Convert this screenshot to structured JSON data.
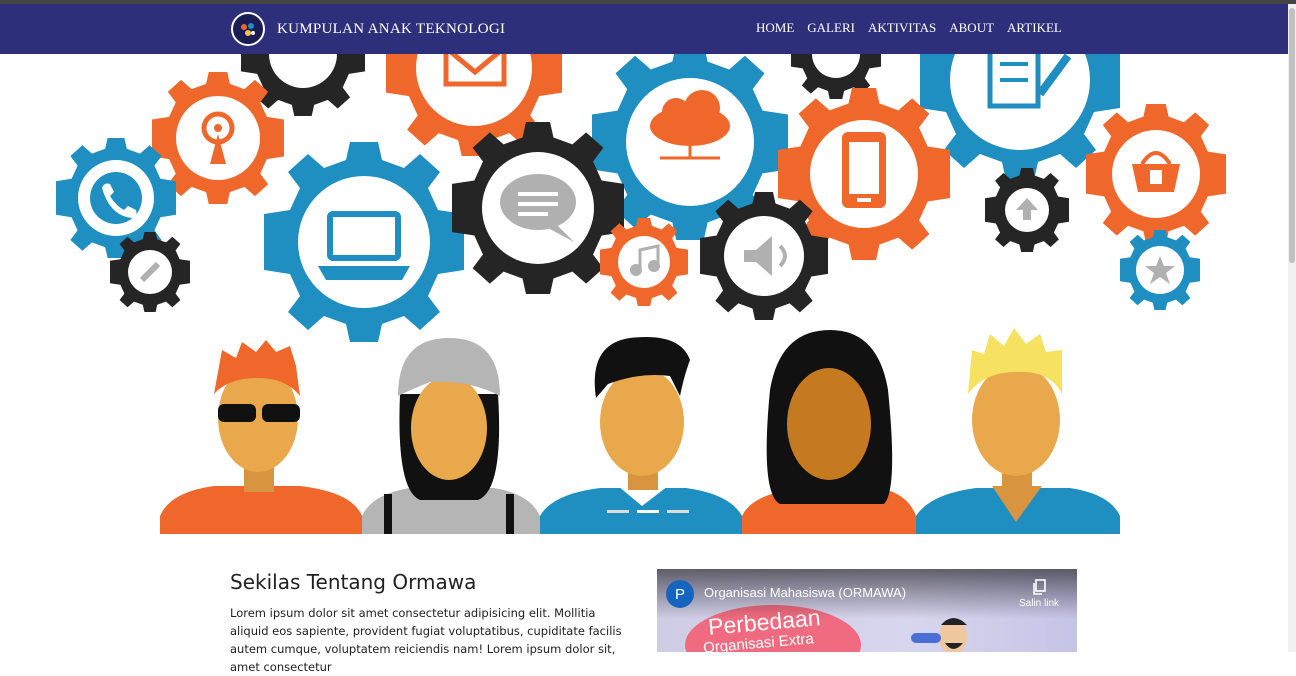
{
  "navbar": {
    "brand": "KUMPULAN ANAK TEKNOLOGI",
    "logo_icon": "kuat-logo-icon",
    "items": [
      {
        "label": "HOME"
      },
      {
        "label": "GALERI"
      },
      {
        "label": "AKTIVITAS"
      },
      {
        "label": "ABOUT"
      },
      {
        "label": "ARTIKEL"
      }
    ],
    "background": "#2d2f7a"
  },
  "hero": {
    "carousel_active_index": 1,
    "carousel_count": 3,
    "colors": {
      "orange": "#f0672b",
      "blue": "#1e8fc0",
      "dark": "#252525"
    }
  },
  "about": {
    "title": "Sekilas Tentang Ormawa",
    "text": "Lorem ipsum dolor sit amet consectetur adipisicing elit. Mollitia aliquid eos sapiente, provident fugiat voluptatibus, cupiditate facilis autem cumque, voluptatem reiciendis nam! Lorem ipsum dolor sit, amet consectetur"
  },
  "video": {
    "channel_initial": "P",
    "title": "Organisasi Mahasiswa (ORMAWA)",
    "copy_label": "Salin link",
    "thumb_text_1": "Perbedaan",
    "thumb_text_2": "Organisasi Extra"
  }
}
